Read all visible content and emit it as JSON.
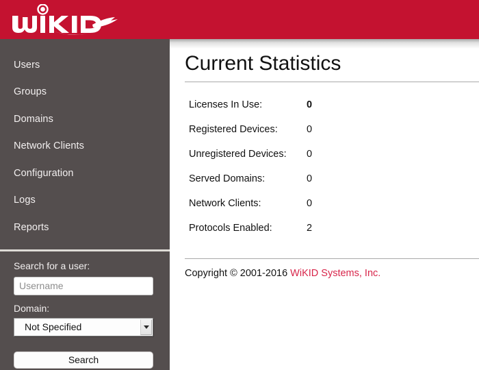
{
  "header": {
    "logo_text": "WiKID",
    "brand_color": "#c41230"
  },
  "sidebar": {
    "background_color": "#544e4e",
    "nav_items": [
      {
        "label": "Users",
        "name": "users"
      },
      {
        "label": "Groups",
        "name": "groups"
      },
      {
        "label": "Domains",
        "name": "domains"
      },
      {
        "label": "Network Clients",
        "name": "network-clients"
      },
      {
        "label": "Configuration",
        "name": "configuration"
      },
      {
        "label": "Logs",
        "name": "logs"
      },
      {
        "label": "Reports",
        "name": "reports"
      }
    ],
    "search_panel": {
      "heading": "Search for a user:",
      "username_value": "",
      "username_placeholder": "Username",
      "domain_label": "Domain:",
      "domain_selected": "Not Specified",
      "domain_options": [
        "Not Specified"
      ],
      "search_button_label": "Search"
    }
  },
  "main": {
    "title": "Current Statistics",
    "stats": [
      {
        "label": "Licenses In Use:",
        "value": "0",
        "bold": true
      },
      {
        "label": "Registered Devices:",
        "value": "0",
        "bold": false
      },
      {
        "label": "Unregistered Devices:",
        "value": "0",
        "bold": false
      },
      {
        "label": "Served Domains:",
        "value": "0",
        "bold": false
      },
      {
        "label": "Network Clients:",
        "value": "0",
        "bold": false
      },
      {
        "label": "Protocols Enabled:",
        "value": "2",
        "bold": false
      }
    ],
    "footer": {
      "copyright_text": "Copyright © 2001-2016",
      "company_link": "WiKID Systems, Inc.",
      "link_color": "#d8254a"
    }
  }
}
